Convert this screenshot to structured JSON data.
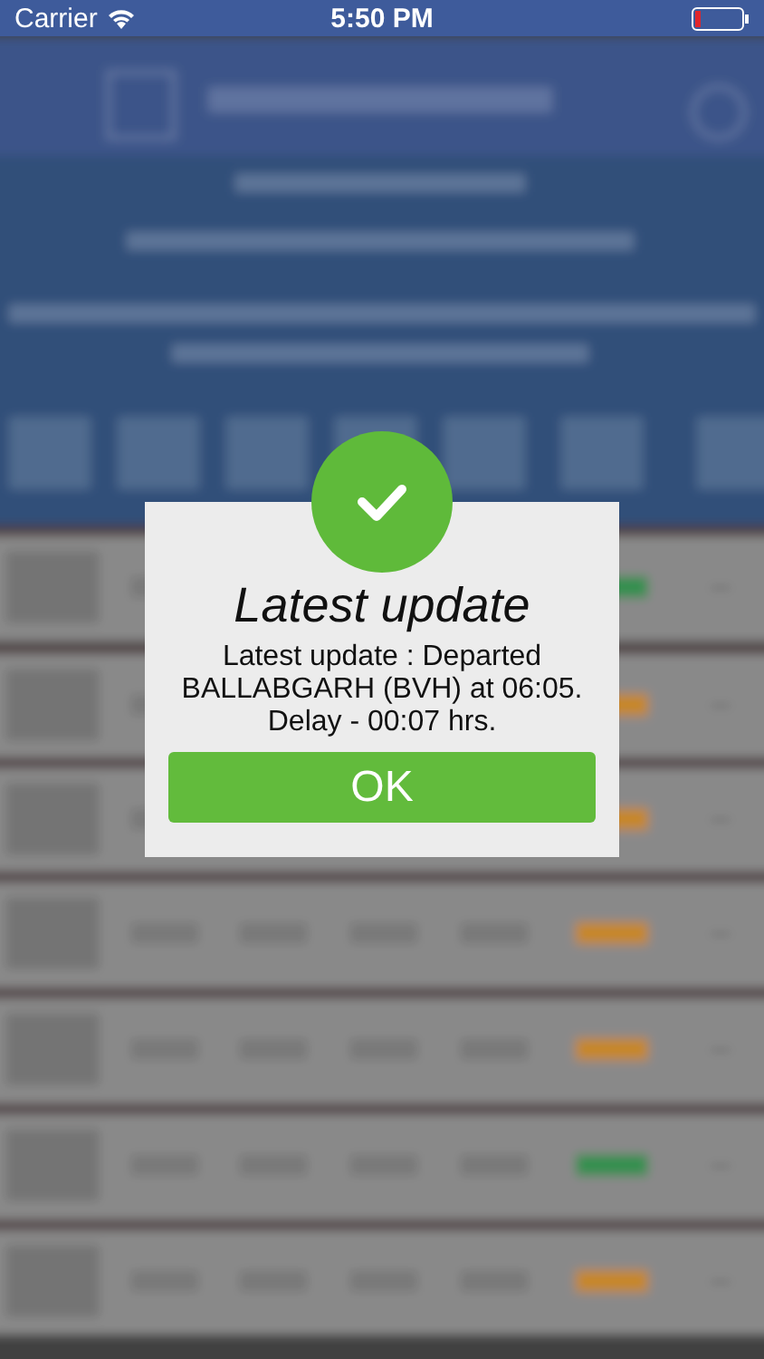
{
  "status_bar": {
    "carrier": "Carrier",
    "time": "5:50 PM"
  },
  "dialog": {
    "title": "Latest update",
    "message": "Latest update : Departed BALLABGARH (BVH) at 06:05. Delay - 00:07 hrs.",
    "button": "OK"
  }
}
